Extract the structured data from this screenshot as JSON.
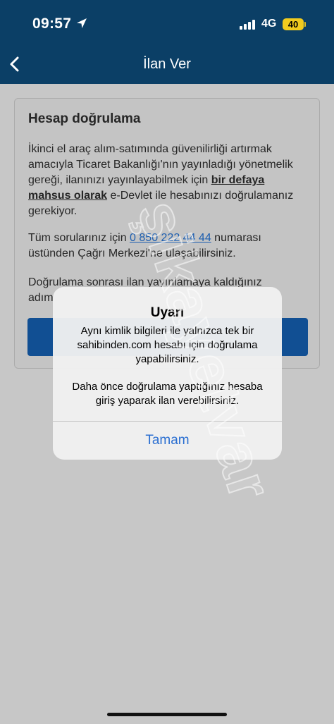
{
  "status_bar": {
    "time": "09:57",
    "network": "4G",
    "battery": "40",
    "battery_color": "#f1cb1e"
  },
  "nav": {
    "title": "İlan Ver",
    "background": "#0b3f66"
  },
  "card": {
    "title": "Hesap doğrulama",
    "p1_before": "İkinci el araç alım-satımında güvenilirliği artırmak amacıyla Ticaret Bakanlığı'nın yayınladığı yönetmelik gereği, ilanınızı yayınlayabilmek için ",
    "p1_bold": "bir defaya mahsus olarak",
    "p1_after": " e-Devlet ile hesabınızı doğrulamanız gerekiyor.",
    "p2_before": "Tüm sorularınız için ",
    "p2_phone": "0 850 222 44 44",
    "p2_after": " numarası üstünden Çağrı Merkezi'ne ulaşabilirsiniz.",
    "p3_line1": "Doğrulama sonrası ilan yayınlamaya kaldığınız",
    "p3_line2": "adım"
  },
  "alert": {
    "title": "Uyarı",
    "message1": "Aynı kimlik bilgileri ile yalnızca tek bir sahibinden.com hesabı için doğrulama yapabilirsiniz.",
    "message2": "Daha önce doğrulama yaptığınız hesaba giriş yaparak ilan verebilirsiniz.",
    "button": "Tamam",
    "button_color": "#2b6fd1"
  },
  "watermark": "şikayetvar"
}
